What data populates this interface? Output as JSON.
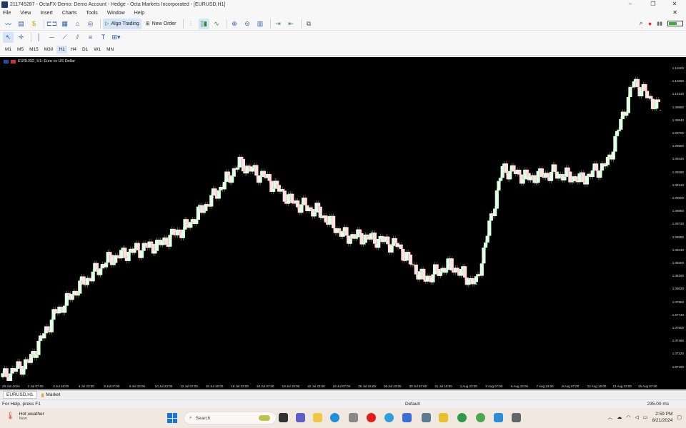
{
  "window": {
    "title": "211745287 - OctaFX-Demo: Demo Account - Hedge - Octa Markets Incorporated - [EURUSD,H1]",
    "controls": [
      "–",
      "❐",
      "✕"
    ],
    "mdi_close": "✕"
  },
  "menu": [
    "File",
    "View",
    "Insert",
    "Charts",
    "Tools",
    "Window",
    "Help"
  ],
  "toolbar": {
    "algo_trading": "Algo Trading",
    "new_order": "New Order"
  },
  "timeframes": [
    "M1",
    "M5",
    "M15",
    "M30",
    "H1",
    "H4",
    "D1",
    "W1",
    "MN"
  ],
  "active_timeframe": "H1",
  "chart": {
    "label": "EURUSD, H1: Euro vs US Dollar",
    "background": "#000000",
    "bull_fill": "#e2ffe6",
    "bear_fill": "#ffe0e3",
    "price_ticks": [
      "1.10400",
      "1.10260",
      "1.10120",
      "1.09980",
      "1.09840",
      "1.09700",
      "1.09560",
      "1.09420",
      "1.09280",
      "1.09140",
      "1.09000",
      "1.08860",
      "1.08720",
      "1.08580",
      "1.08440",
      "1.08300",
      "1.08160",
      "1.08020",
      "1.07880",
      "1.07740",
      "1.07600",
      "1.07460",
      "1.07320",
      "1.07180"
    ],
    "time_ticks": [
      "28 Jun 2024",
      "2 Jul 07:00",
      "3 Jul 15:00",
      "4 Jul 23:00",
      "8 Jul 07:00",
      "9 Jul 15:00",
      "10 Jul 23:00",
      "12 Jul 07:00",
      "15 Jul 15:00",
      "16 Jul 23:00",
      "18 Jul 07:00",
      "19 Jul 15:00",
      "22 Jul 23:00",
      "24 Jul 07:00",
      "25 Jul 15:00",
      "26 Jul 23:00",
      "30 Jul 07:00",
      "31 Jul 15:00",
      "1 Aug 23:00",
      "5 Aug 07:00",
      "6 Aug 15:00",
      "7 Aug 23:00",
      "9 Aug 07:00",
      "12 Aug 15:00",
      "13 Aug 23:00",
      "15 Aug 07:00"
    ]
  },
  "chart_data": {
    "type": "line",
    "x": [
      "28 Jun 2024",
      "2 Jul 07:00",
      "3 Jul 15:00",
      "4 Jul 23:00",
      "8 Jul 07:00",
      "9 Jul 15:00",
      "10 Jul 23:00",
      "12 Jul 07:00",
      "15 Jul 15:00",
      "16 Jul 23:00",
      "18 Jul 07:00",
      "19 Jul 15:00",
      "22 Jul 23:00",
      "24 Jul 07:00",
      "25 Jul 15:00",
      "26 Jul 23:00",
      "30 Jul 07:00",
      "31 Jul 15:00",
      "1 Aug 23:00",
      "5 Aug 07:00",
      "6 Aug 15:00",
      "7 Aug 23:00",
      "9 Aug 07:00",
      "12 Aug 15:00",
      "13 Aug 23:00",
      "15 Aug 07:00"
    ],
    "series": [
      {
        "values": [
          1.0714,
          1.073,
          1.078,
          1.081,
          1.0835,
          1.0845,
          1.0852,
          1.087,
          1.09,
          1.0935,
          1.092,
          1.0895,
          1.0885,
          1.086,
          1.0858,
          1.085,
          1.0815,
          1.083,
          1.081,
          1.093,
          1.092,
          1.0925,
          1.0918,
          1.0935,
          1.102,
          1.099
        ]
      }
    ],
    "ylim": [
      1.071,
      1.1045
    ],
    "grid": false
  },
  "tabs": [
    "EURUSD,H1",
    "Market"
  ],
  "status": {
    "help": "For Help, press F1",
    "profile": "Default",
    "ping": "235.00 ms"
  },
  "taskbar": {
    "weather_title": "Hot weather",
    "weather_sub": "Now",
    "search": "Search",
    "time": "2:59 PM",
    "date": "8/21/2024"
  }
}
